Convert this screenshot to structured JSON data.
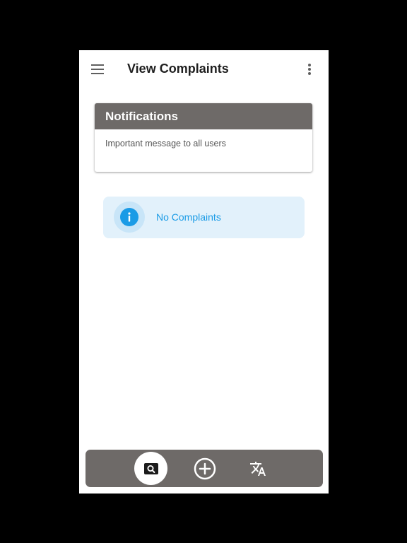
{
  "appbar": {
    "title": "View Complaints",
    "menu_icon": "hamburger-menu-icon",
    "more_icon": "more-vert-icon"
  },
  "notifications": {
    "header": "Notifications",
    "message": "Important message to all users"
  },
  "alert": {
    "icon": "info-icon",
    "text": "No Complaints"
  },
  "bottom_nav": {
    "items": [
      {
        "icon": "image-search-icon",
        "active": true
      },
      {
        "icon": "add-circle-icon",
        "active": false
      },
      {
        "icon": "translate-icon",
        "active": false
      }
    ]
  },
  "colors": {
    "background": "#000000",
    "surface": "#ffffff",
    "card_header": "#6e6a68",
    "bottom_nav": "#6e6a68",
    "info_blue": "#1a9be6",
    "info_background": "#e2f1fb"
  }
}
